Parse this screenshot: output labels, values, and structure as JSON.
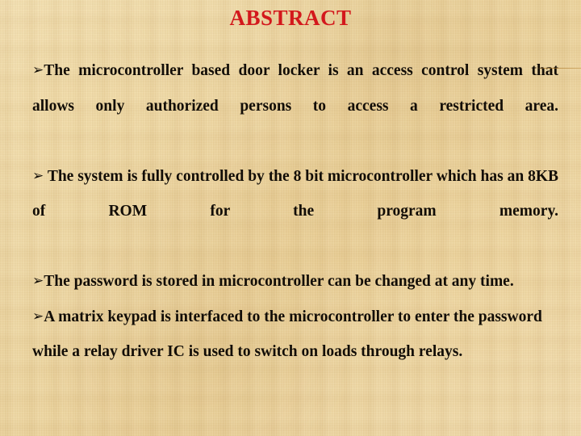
{
  "slide": {
    "title": "ABSTRACT",
    "title_color": "#d3181c",
    "text_color": "#120d07",
    "background_color": "#eed9a8",
    "bullet_glyph": "➢",
    "paragraphs": [
      {
        "id": "p1",
        "bullet": "➢",
        "lead_space": "",
        "text": "The microcontroller based door locker is an access control system that allows only authorized persons to access a restricted area."
      },
      {
        "id": "p2",
        "bullet": "➢",
        "lead_space": " ",
        "text": "The system is fully controlled by the 8 bit microcontroller which has an 8KB of ROM for the program memory."
      },
      {
        "id": "p3",
        "bullet": "➢",
        "lead_space": "",
        "text": "The password is stored in microcontroller can be changed at any time."
      },
      {
        "id": "p4",
        "bullet": "➢",
        "lead_space": "",
        "text": "A matrix keypad is interfaced to the microcontroller to enter the password while a relay driver IC is used to switch on loads through relays."
      }
    ]
  }
}
